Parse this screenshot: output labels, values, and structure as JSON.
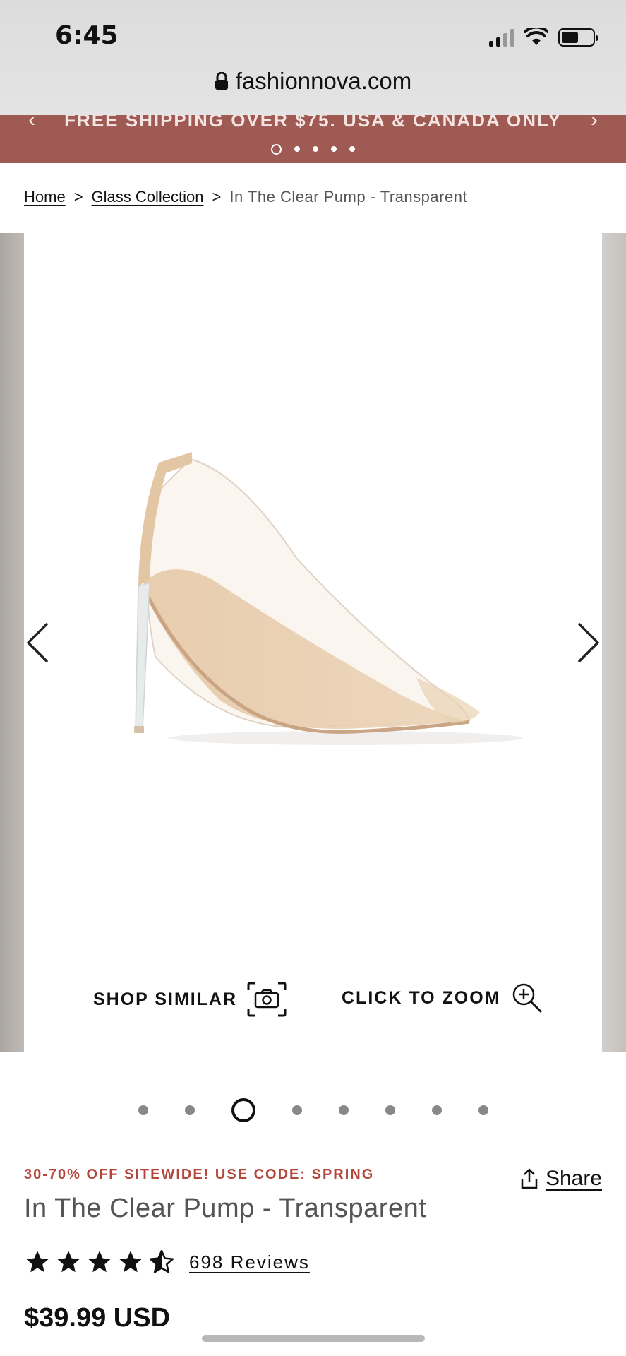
{
  "status_bar": {
    "time": "6:45"
  },
  "url_bar": {
    "domain": "fashionnova.com"
  },
  "promo_banner": {
    "text": "FREE SHIPPING OVER $75. USA & CANADA ONLY",
    "active_index": 0,
    "dot_count": 5
  },
  "breadcrumb": {
    "items": [
      "Home",
      "Glass Collection"
    ],
    "current": "In The Clear Pump - Transparent"
  },
  "gallery": {
    "shop_similar_label": "SHOP SIMILAR",
    "click_to_zoom_label": "CLICK TO ZOOM",
    "image_count": 8,
    "active_index": 2
  },
  "product": {
    "promo": "30-70% OFF SITEWIDE! USE CODE: SPRING",
    "share_label": "Share",
    "title": "In The Clear Pump - Transparent",
    "rating": 4.5,
    "reviews_label": "698 Reviews",
    "price": "$39.99 USD"
  },
  "colors": {
    "promo_banner": "#9e5a53",
    "promo_code_text": "#b4453b"
  }
}
